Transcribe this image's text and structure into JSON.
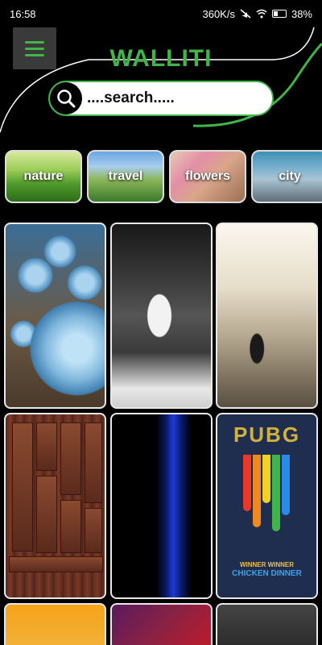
{
  "status_bar": {
    "time": "16:58",
    "network_speed": "360K/s",
    "battery_percent": "38%",
    "battery_level": 0.38,
    "icons": [
      "mute-icon",
      "wifi-icon",
      "battery-icon"
    ]
  },
  "header": {
    "title": "WALLITI",
    "menu_icon": "hamburger-menu-icon",
    "accent_color": "#3fb54a"
  },
  "search": {
    "placeholder": "....search....."
  },
  "categories": [
    {
      "label": "nature"
    },
    {
      "label": "travel"
    },
    {
      "label": "flowers"
    },
    {
      "label": "city"
    }
  ],
  "wallpapers": [
    {
      "subject": "blue-spheres"
    },
    {
      "subject": "a-simple-life-mug"
    },
    {
      "subject": "cyclist-street"
    },
    {
      "subject": "wooden-panels"
    },
    {
      "subject": "blue-light-lines"
    },
    {
      "subject": "pubg-chicken-dinner",
      "text_main": "PUBG",
      "text_line1": "WINNER WINNER",
      "text_line2": "CHICKEN DINNER"
    },
    {
      "subject": "orange"
    },
    {
      "subject": "purple-red-gradient"
    },
    {
      "subject": "dark-gray"
    }
  ]
}
